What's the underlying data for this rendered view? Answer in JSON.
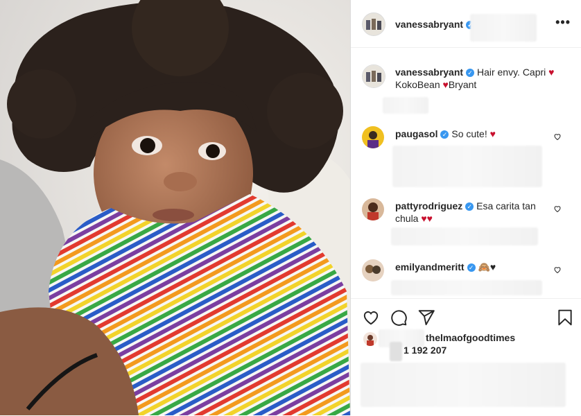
{
  "header": {
    "username": "vanessabryant",
    "verified_glyph": "✓",
    "more_glyph": "•••"
  },
  "caption": {
    "username": "vanessabryant",
    "text_1": "Hair envy. Capri ",
    "heart": "♥",
    "text_2": "KokoBean ",
    "text_3": "Bryant"
  },
  "comments": [
    {
      "username": "paugasol",
      "text": "So cute! ",
      "hearts": "♥"
    },
    {
      "username": "pattyrodriguez",
      "text": "Esa carita tan chula ",
      "hearts": "♥♥"
    },
    {
      "username": "emilyandmeritt",
      "text": "🙈♥",
      "hearts": ""
    }
  ],
  "likes": {
    "liker": "thelmaofgoodtimes",
    "count": "1 192 207"
  },
  "icons": [
    "more-icon",
    "like-icon",
    "comment-icon",
    "share-icon",
    "save-icon",
    "comment-like-icon"
  ],
  "colors": {
    "verified": "#3897f0",
    "heart": "#c8102e",
    "text": "#262626"
  }
}
